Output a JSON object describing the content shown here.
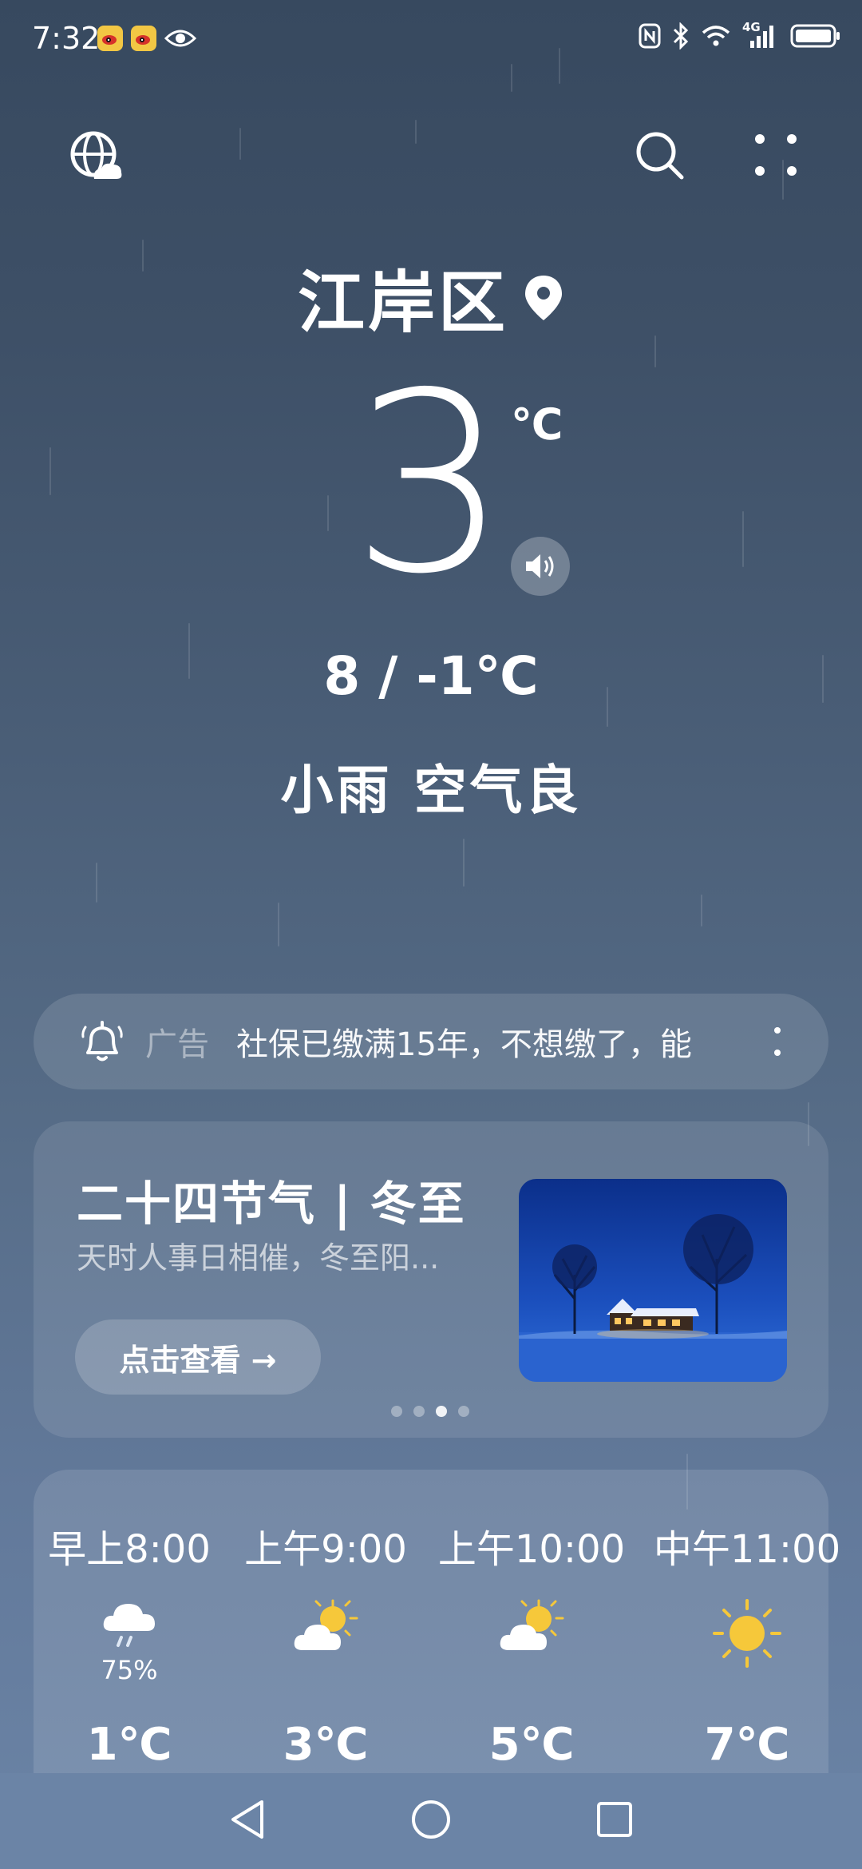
{
  "status_bar": {
    "time": "7:32",
    "network": "4G",
    "notification_icons": [
      "weibo-icon",
      "weibo-icon",
      "eye-icon"
    ],
    "right_icons": [
      "nfc-icon",
      "bluetooth-icon",
      "wifi-icon",
      "signal-icon",
      "battery-icon"
    ]
  },
  "header": {
    "left_icon": "globe-cloud-icon",
    "right_icons": [
      "search-icon",
      "more-grid-icon"
    ]
  },
  "location": {
    "name": "江岸区",
    "icon": "location-pin-icon"
  },
  "current": {
    "temperature": "3",
    "unit": "℃",
    "range": "8 / -1℃",
    "condition": "小雨 空气良"
  },
  "ad": {
    "tag": "广告",
    "text": "社保已缴满15年，不想缴了，能"
  },
  "solar_term": {
    "title": "二十四节气 | 冬至",
    "subtitle": "天时人事日相催，冬至阳...",
    "button_label": "点击查看 →",
    "dots_total": 4,
    "dots_active_index": 2
  },
  "hourly": [
    {
      "time": "早上8:00",
      "icon": "rain-cloud-icon",
      "pop": "75%",
      "temp": "1℃"
    },
    {
      "time": "上午9:00",
      "icon": "partly-cloudy-icon",
      "pop": "",
      "temp": "3℃"
    },
    {
      "time": "上午10:00",
      "icon": "partly-cloudy-icon",
      "pop": "",
      "temp": "5℃"
    },
    {
      "time": "中午11:00",
      "icon": "sun-icon",
      "pop": "",
      "temp": "7℃"
    }
  ],
  "colors": {
    "background_top": "#37495f",
    "background_bottom": "#6b84a6",
    "sun": "#f6c83a"
  }
}
